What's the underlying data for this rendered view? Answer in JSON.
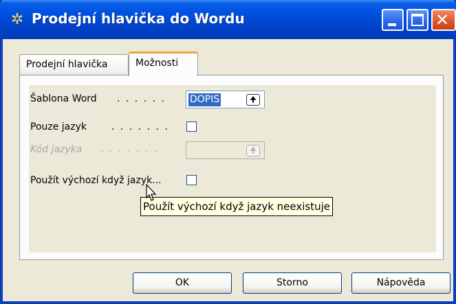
{
  "window": {
    "title": "Prodejní hlavička do Wordu",
    "icon": "gear-icon"
  },
  "tabs": [
    {
      "label": "Prodejní hlavička",
      "active": false
    },
    {
      "label": "Možnosti",
      "active": true
    }
  ],
  "fields": {
    "template": {
      "label": "Šablona Word",
      "dots": ". . . . . .",
      "value": "DOPIS",
      "lookup_icon": "lookup-arrow-icon"
    },
    "language_only": {
      "label": "Pouze jazyk",
      "dots": ". . . . . . .",
      "checked": false
    },
    "language_code": {
      "label": "Kód jazyka",
      "dots": ". . . . . . .",
      "value": "",
      "disabled": true,
      "lookup_icon": "lookup-arrow-icon"
    },
    "use_default": {
      "label": "Použít výchozí když jazyk...",
      "checked": false
    }
  },
  "tooltip": {
    "text": "Použít výchozí když jazyk neexistuje"
  },
  "buttons": {
    "ok": "OK",
    "cancel": "Storno",
    "help": "Nápověda"
  },
  "colors": {
    "titlebar": "#0050e0",
    "selection": "#316ac5",
    "active_tab_accent": "#f0a43c",
    "tooltip_bg": "#ffffe1"
  }
}
